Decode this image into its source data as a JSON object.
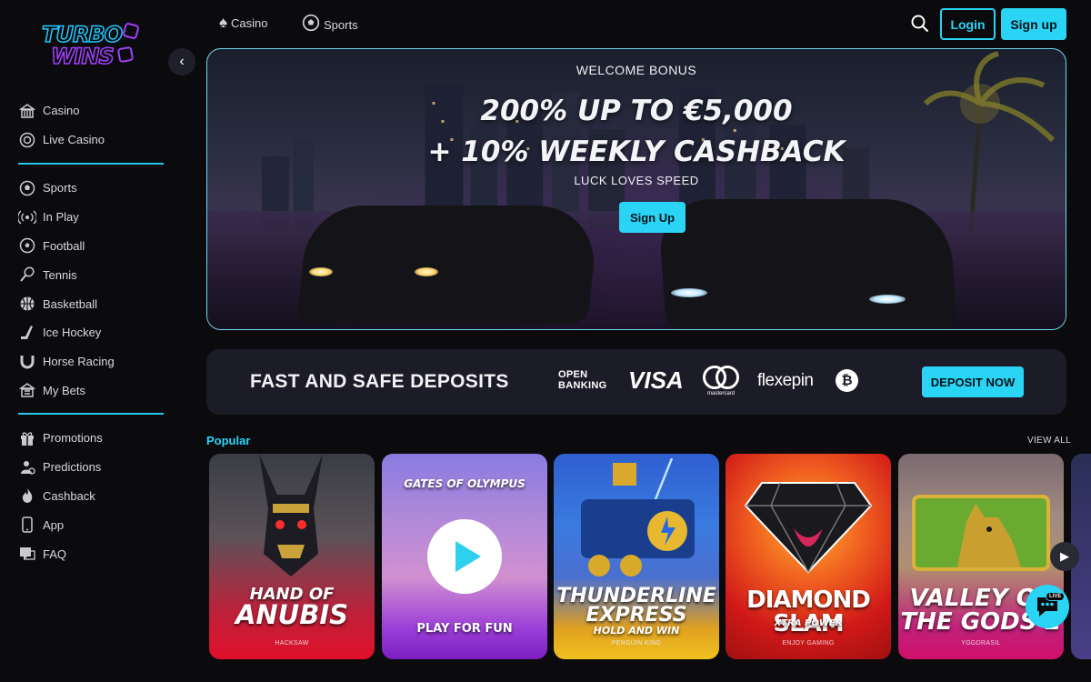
{
  "brand": {
    "logo_line1": "TURBO",
    "logo_line2": "WINS"
  },
  "topnav": {
    "casino_label": "Casino",
    "sports_label": "Sports",
    "login_label": "Login",
    "signup_label": "Sign up"
  },
  "sidebar": {
    "group1": [
      {
        "label": "Casino",
        "icon": "casino-icon"
      },
      {
        "label": "Live Casino",
        "icon": "live-casino-icon"
      }
    ],
    "group2": [
      {
        "label": "Sports",
        "icon": "sports-icon"
      },
      {
        "label": "In Play",
        "icon": "in-play-icon"
      },
      {
        "label": "Football",
        "icon": "football-icon"
      },
      {
        "label": "Tennis",
        "icon": "tennis-icon"
      },
      {
        "label": "Basketball",
        "icon": "basketball-icon"
      },
      {
        "label": "Ice Hockey",
        "icon": "ice-hockey-icon"
      },
      {
        "label": "Horse Racing",
        "icon": "horse-racing-icon"
      },
      {
        "label": "My Bets",
        "icon": "my-bets-icon"
      }
    ],
    "group3": [
      {
        "label": "Promotions",
        "icon": "gift-icon"
      },
      {
        "label": "Predictions",
        "icon": "predictions-icon"
      },
      {
        "label": "Cashback",
        "icon": "flame-icon"
      },
      {
        "label": "App",
        "icon": "phone-icon"
      },
      {
        "label": "FAQ",
        "icon": "faq-icon"
      }
    ]
  },
  "hero": {
    "eyebrow": "WELCOME BONUS",
    "title_line1": "200% UP TO €5,000",
    "title_line2": "+ 10% WEEKLY CASHBACK",
    "subtitle": "LUCK LOVES SPEED",
    "cta_label": "Sign Up"
  },
  "deposits": {
    "title": "FAST AND SAFE DEPOSITS",
    "open_banking_line1": "OPEN",
    "open_banking_line2": "BANKING",
    "visa": "VISA",
    "mastercard": "mastercard",
    "flexepin": "flexepin",
    "bitcoin_symbol": "₿",
    "cta_label": "DEPOSIT NOW"
  },
  "popular": {
    "title": "Popular",
    "view_all_label": "VIEW ALL",
    "games": [
      {
        "title_line1": "HAND OF",
        "title_line2": "ANUBIS",
        "provider": "HACKSAW"
      },
      {
        "title_top": "GATES OF OLYMPUS",
        "play_label": "PLAY FOR FUN"
      },
      {
        "title_line1": "THUNDERLINE",
        "title_line2": "EXPRESS",
        "title_line3": "HOLD AND WIN",
        "provider": "PENGUIN KING"
      },
      {
        "title_line1": "DIAMOND SLAM",
        "title_line2": "XTRA POWER",
        "provider": "ENJOY GAMING"
      },
      {
        "title_line1": "VALLEY OF",
        "title_line2": "THE GODS 2",
        "provider": "YGGDRASIL"
      }
    ]
  },
  "chat": {
    "badge": "LIVE"
  },
  "colors": {
    "accent": "#29d4f5",
    "purple": "#a341ff",
    "bg": "#0b0b0e",
    "panel": "#1c1b28"
  }
}
